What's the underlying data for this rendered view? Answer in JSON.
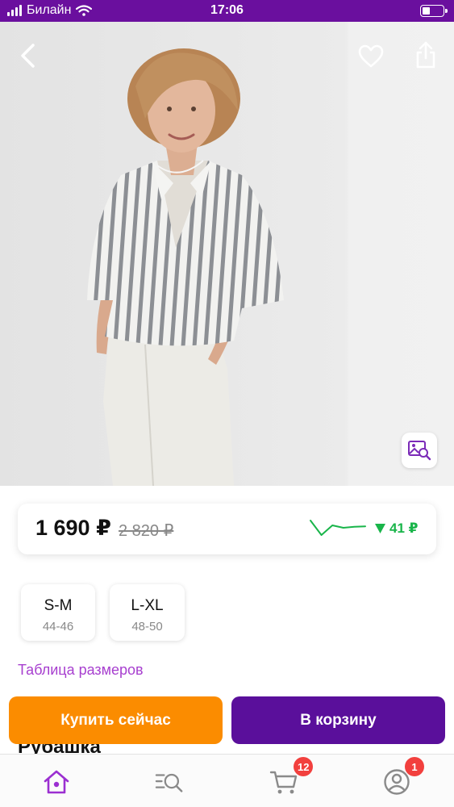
{
  "status_bar": {
    "carrier": "Билайн",
    "time": "17:06",
    "battery_percent": 30
  },
  "product": {
    "image_subject": "Woman in grey-white striped short-sleeve shirt and white jeans"
  },
  "price": {
    "current": "1 690 ₽",
    "old": "2 820 ₽",
    "change": "41 ₽",
    "change_direction": "down",
    "change_color": "#19b54a",
    "trend_values": [
      4,
      1,
      3,
      2.5,
      2.7,
      2.8
    ]
  },
  "sizes": [
    {
      "label": "S-M",
      "ru": "44-46"
    },
    {
      "label": "L-XL",
      "ru": "48-50"
    }
  ],
  "size_table_link": "Таблица размеров",
  "title": "Рубашка",
  "buttons": {
    "buy_now": "Купить сейчас",
    "add_to_cart": "В корзину"
  },
  "tabbar": {
    "cart_badge": "12",
    "profile_badge": "1"
  },
  "colors": {
    "brand_purple": "#6a0f9e",
    "buy_orange": "#fb8c00",
    "cart_purple": "#5a0f9b",
    "link_purple": "#a73fcf",
    "badge_red": "#f2403e"
  },
  "icons": [
    "back-arrow-icon",
    "heart-icon",
    "share-icon",
    "image-search-icon",
    "home-icon",
    "catalog-search-icon",
    "cart-icon",
    "profile-icon",
    "wifi-icon",
    "signal-icon",
    "battery-icon"
  ]
}
